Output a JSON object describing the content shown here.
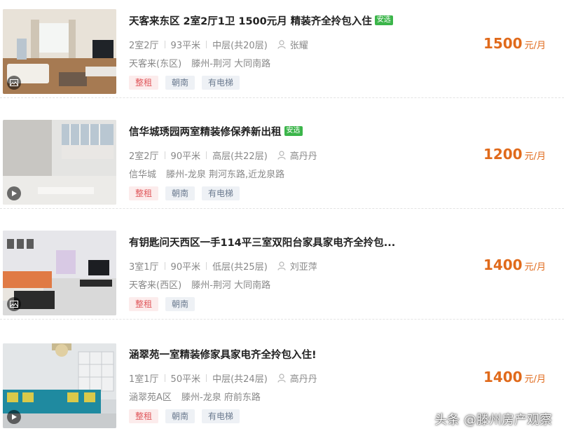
{
  "listings": [
    {
      "title": "天客来东区 2室2厅1卫 1500元月 精装齐全拎包入住",
      "badge": "安选",
      "layout": "2室2厅",
      "area": "93平米",
      "floor": "中层(共20层)",
      "agent": "张耀",
      "community": "天客来(东区)",
      "location": "滕州-荆河 大同南路",
      "tags": [
        "整租",
        "朝南",
        "有电梯"
      ],
      "price": "1500",
      "price_unit": "元/月",
      "media_icon": "picture-icon"
    },
    {
      "title": "信华城琇园两室精装修保养新出租",
      "badge": "安选",
      "layout": "2室2厅",
      "area": "90平米",
      "floor": "高层(共22层)",
      "agent": "高丹丹",
      "community": "信华城",
      "location": "滕州-龙泉 荆河东路,近龙泉路",
      "tags": [
        "整租",
        "朝南",
        "有电梯"
      ],
      "price": "1200",
      "price_unit": "元/月",
      "media_icon": "play-icon"
    },
    {
      "title": "有钥匙问天西区一手114平三室双阳台家具家电齐全拎包...",
      "badge": "",
      "layout": "3室1厅",
      "area": "90平米",
      "floor": "低层(共25层)",
      "agent": "刘亚萍",
      "community": "天客来(西区)",
      "location": "滕州-荆河 大同南路",
      "tags": [
        "整租",
        "朝南"
      ],
      "price": "1400",
      "price_unit": "元/月",
      "media_icon": "picture-icon"
    },
    {
      "title": "涵翠苑一室精装修家具家电齐全拎包入住!",
      "badge": "",
      "layout": "1室1厅",
      "area": "50平米",
      "floor": "中层(共24层)",
      "agent": "高丹丹",
      "community": "涵翠苑A区",
      "location": "滕州-龙泉 府前东路",
      "tags": [
        "整租",
        "朝南",
        "有电梯"
      ],
      "price": "1400",
      "price_unit": "元/月",
      "media_icon": "play-icon"
    }
  ],
  "watermark": "头条 @滕州房产观察",
  "colors": {
    "price": "#e06a1b",
    "badge": "#3bb54a",
    "tag_red": "#e0595d",
    "tag_gray": "#6b7a8f"
  }
}
